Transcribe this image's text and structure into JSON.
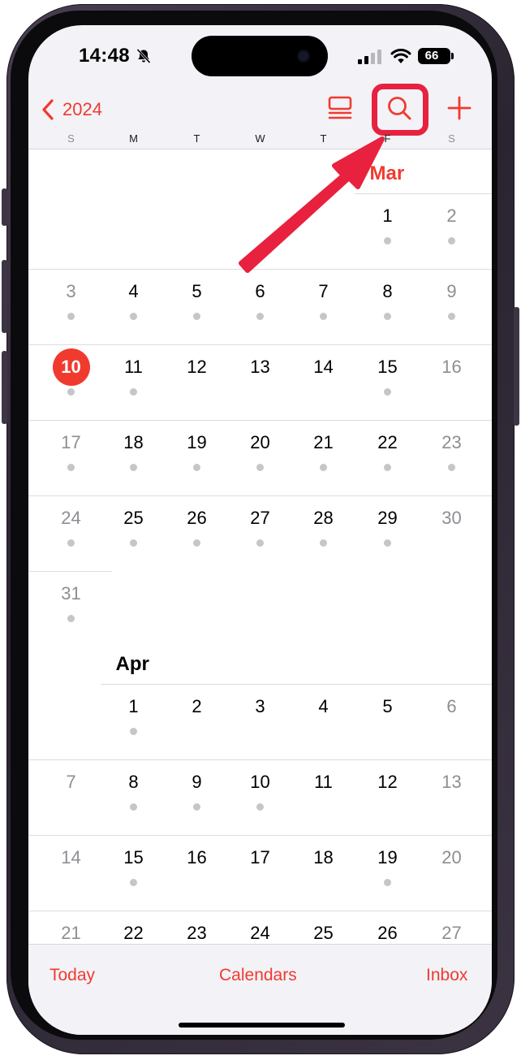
{
  "status": {
    "time": "14:48",
    "battery": "66",
    "icons": [
      "bell-slash-icon",
      "cellular-signal-icon",
      "wifi-icon",
      "battery-icon"
    ]
  },
  "nav": {
    "back_label": "2024",
    "icons": [
      "chevron-left-icon",
      "list-view-icon",
      "search-icon",
      "plus-icon"
    ]
  },
  "weekdays": [
    "S",
    "M",
    "T",
    "W",
    "T",
    "F",
    "S"
  ],
  "months": [
    {
      "name": "Mar",
      "first_weekday": 5,
      "days": 31,
      "today": 10,
      "dot_days": [
        1,
        2,
        3,
        4,
        5,
        6,
        7,
        8,
        9,
        10,
        11,
        15,
        17,
        18,
        19,
        20,
        21,
        22,
        23,
        24,
        25,
        26,
        27,
        28,
        29,
        31
      ]
    },
    {
      "name": "Apr",
      "first_weekday": 1,
      "days": 27,
      "today": null,
      "dot_days": [
        1,
        8,
        9,
        10,
        15,
        19
      ]
    }
  ],
  "tabs": {
    "today": "Today",
    "calendars": "Calendars",
    "inbox": "Inbox"
  },
  "colors": {
    "accent": "#f13a2e",
    "highlight": "#e8213f",
    "weekend_text": "#8e8e93",
    "event_dot": "#c6c6c9"
  }
}
